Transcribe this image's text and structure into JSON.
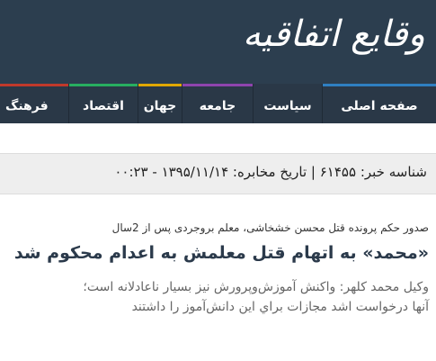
{
  "logo": {
    "text": "وقایع اتفاقیه"
  },
  "nav": {
    "items": [
      {
        "label": "صفحه اصلی",
        "accent": "#2f7fc1"
      },
      {
        "label": "سیاست",
        "accent": "#2a3847"
      },
      {
        "label": "جامعه",
        "accent": "#8e44ad"
      },
      {
        "label": "جهان",
        "accent": "#e0a800"
      },
      {
        "label": "اقتصاد",
        "accent": "#27ae60"
      },
      {
        "label": "فرهنگ",
        "accent": "#c0392b"
      }
    ]
  },
  "info": {
    "text": "شناسه خبر: ۶۱۴۵۵ | تاریخ مخابره: ۱۳۹۵/۱۱/۱۴ - ۰۰:۲۳"
  },
  "article": {
    "rutitr": "صدور حکم پرونده قتل محسن خشخاشی، معلم بروجردی پس از 2سال",
    "headline": "«محمد» به اتهام قتل معلمش به اعدام محکوم شد",
    "lead_line1": "وکیل محمد کلهر: واکنش آموزش‌وپرورش نیز بسیار ناعادلانه است؛",
    "lead_line2": "آنها درخواست اشد مجازات براي اين دانش‌آموز را داشتند"
  },
  "colors": {
    "header_bg": "#2c3e4f",
    "nav_bg": "#2a3847",
    "info_bg": "#eeeeee",
    "headline": "#2b3a4b"
  }
}
